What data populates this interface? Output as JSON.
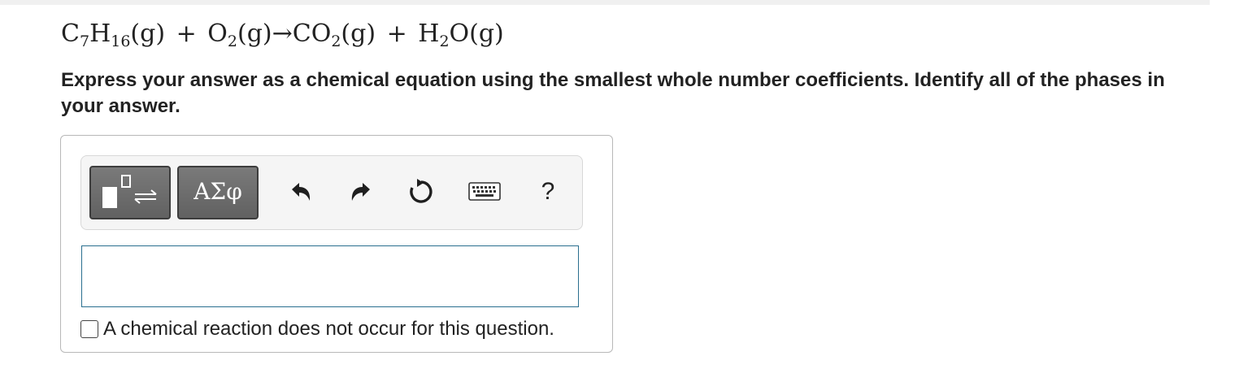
{
  "equation": {
    "reactant1": {
      "el1": "C",
      "sub1": "7",
      "el2": "H",
      "sub2": "16",
      "phase": "(g)"
    },
    "plus1": "+",
    "reactant2": {
      "el1": "O",
      "sub1": "2",
      "phase": "(g)"
    },
    "arrow": "→",
    "product1": {
      "el1": "CO",
      "sub1": "2",
      "phase": "(g)"
    },
    "plus2": "+",
    "product2": {
      "el1": "H",
      "sub1": "2",
      "el2": "O",
      "phase": "(g)"
    }
  },
  "instructions": "Express your answer as a chemical equation using the smallest whole number coefficients. Identify all of the phases in your answer.",
  "toolbar": {
    "templates_icon": "templates-reaction-icon",
    "symbols_label": "ΑΣφ",
    "undo_icon": "undo-icon",
    "redo_icon": "redo-icon",
    "reset_icon": "reset-icon",
    "keyboard_icon": "keyboard-icon",
    "help_label": "?"
  },
  "answer": {
    "value": ""
  },
  "no_reaction_label": "A chemical reaction does not occur for this question.",
  "colors": {
    "input_border": "#2a6f8f",
    "button_fill": "#6e6e6e",
    "toolbar_bg": "#f5f5f5"
  }
}
